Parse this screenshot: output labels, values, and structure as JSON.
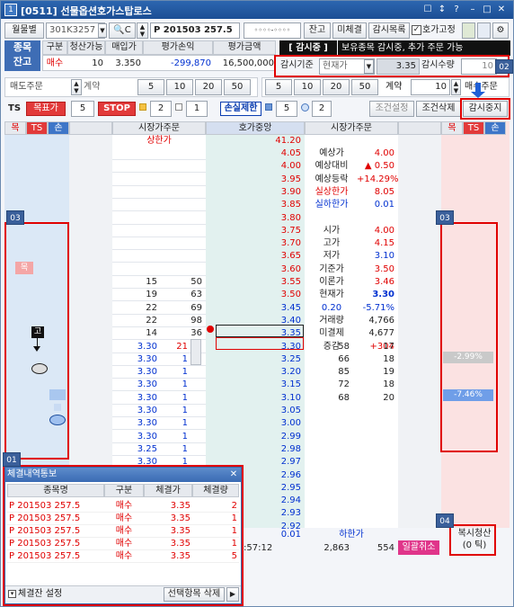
{
  "window": {
    "title_no": "1",
    "title": "[0511] 선물옵션호가스탑로스",
    "btn_labels": [
      "☐",
      "↕",
      "?",
      "–",
      "□",
      "✕"
    ]
  },
  "toolbar": {
    "mode": "월물별",
    "account": "301K3257",
    "code_prefix": "C",
    "code": "P 201503 257.5",
    "password_mask": "◦◦◦◦-◦◦◦◦",
    "balance_btn": "잔고",
    "unfilled_btn": "미체결",
    "watch_list_btn": "감시목록",
    "price_fix_label": "호가고정"
  },
  "position": {
    "tag_line1": "종목",
    "tag_line2": "잔고",
    "headers": [
      "구분",
      "청산가능",
      "매입가",
      "평가손익",
      "평가금액"
    ],
    "values": [
      "매수",
      "10",
      "3.350",
      "-299,870",
      "16,500,000"
    ]
  },
  "watch": {
    "status": "[ 감시중 ]",
    "message": "보유종목 감시중, 추가 주문 가능",
    "basis_label": "감시기준",
    "basis_value": "현재가",
    "price": "3.35",
    "qty_label": "감시수량",
    "qty_value": "10"
  },
  "order_bar_left": {
    "label": "매도주문",
    "account_label": "계약",
    "qtys": [
      "5",
      "10",
      "20",
      "50"
    ]
  },
  "order_bar_right": {
    "qtys": [
      "5",
      "10",
      "20",
      "50"
    ],
    "account_label": "계약",
    "qty": "10",
    "label": "매수주문"
  },
  "stoploss": {
    "ts_label": "TS",
    "target_label": "목표가",
    "target_val": "5",
    "stop_label": "STOP",
    "stop_val": "2",
    "stop_val2": "1",
    "loss_label": "손실제한",
    "loss_val": "5",
    "loss_val2": "2",
    "cond_set_btn": "조건설정",
    "cond_del_btn": "조건삭제",
    "watch_stop_btn": "감시중지"
  },
  "grid_headers": {
    "left_tags": [
      "목",
      "TS",
      "손"
    ],
    "col1": "시장가주문",
    "col2": "호가중앙",
    "col3": "시장가주문",
    "right_tags": [
      "목",
      "TS",
      "손"
    ]
  },
  "limit_up": {
    "label": "상한가",
    "price": "41.20"
  },
  "ask_rows": [
    {
      "q": "",
      "c": "",
      "p": "4.05"
    },
    {
      "q": "",
      "c": "",
      "p": "4.00"
    },
    {
      "q": "",
      "c": "",
      "p": "3.95"
    },
    {
      "q": "",
      "c": "",
      "p": "3.90"
    },
    {
      "q": "",
      "c": "",
      "p": "3.85"
    },
    {
      "q": "",
      "c": "",
      "p": "3.80"
    },
    {
      "q": "",
      "c": "",
      "p": "3.75"
    },
    {
      "q": "",
      "c": "",
      "p": "3.70"
    },
    {
      "q": "",
      "c": "",
      "p": "3.65"
    },
    {
      "q": "",
      "c": "",
      "p": "3.60"
    },
    {
      "q": "15",
      "c": "50",
      "p": "3.55"
    },
    {
      "q": "19",
      "c": "63",
      "p": "3.50"
    },
    {
      "q": "22",
      "c": "69",
      "p": "3.45"
    },
    {
      "q": "22",
      "c": "98",
      "p": "3.40"
    },
    {
      "q": "14",
      "c": "36",
      "p": "3.35"
    }
  ],
  "info_panel": [
    {
      "k": "예상가",
      "v": "4.00"
    },
    {
      "k": "예상대비",
      "v": "▲ 0.50"
    },
    {
      "k": "예상등락",
      "v": "+14.29%"
    },
    {
      "k": "실상한가",
      "v": "8.05"
    },
    {
      "k": "실하한가",
      "v": "0.01"
    },
    {
      "k": "",
      "v": ""
    },
    {
      "k": "시가",
      "v": "4.00"
    },
    {
      "k": "고가",
      "v": "4.15"
    },
    {
      "k": "저가",
      "v": "3.10"
    },
    {
      "k": "기준가",
      "v": "3.50"
    },
    {
      "k": "이론가",
      "v": "3.46"
    },
    {
      "k": "현재가",
      "v": "3.30"
    },
    {
      "k": "0.20",
      "v": "-5.71%"
    },
    {
      "k": "거래량",
      "v": "4,766"
    },
    {
      "k": "미결제",
      "v": "4,677"
    },
    {
      "k": "증감",
      "v": "+304"
    }
  ],
  "bid_rows": [
    {
      "lp": "3.30",
      "lq": "21",
      "p": "3.30",
      "rq": "58",
      "rc": "17"
    },
    {
      "lp": "3.30",
      "lq": "1",
      "p": "3.25",
      "rq": "66",
      "rc": "18"
    },
    {
      "lp": "3.30",
      "lq": "1",
      "p": "3.20",
      "rq": "85",
      "rc": "19"
    },
    {
      "lp": "3.30",
      "lq": "1",
      "p": "3.15",
      "rq": "72",
      "rc": "18"
    },
    {
      "lp": "3.30",
      "lq": "1",
      "p": "3.10",
      "rq": "68",
      "rc": "20"
    },
    {
      "lp": "3.30",
      "lq": "1",
      "p": "3.05",
      "rq": "",
      "rc": ""
    },
    {
      "lp": "3.30",
      "lq": "1",
      "p": "3.00",
      "rq": "",
      "rc": ""
    },
    {
      "lp": "3.30",
      "lq": "1",
      "p": "2.99",
      "rq": "",
      "rc": ""
    },
    {
      "lp": "3.25",
      "lq": "1",
      "p": "2.98",
      "rq": "",
      "rc": ""
    },
    {
      "lp": "3.30",
      "lq": "1",
      "p": "2.97",
      "rq": "",
      "rc": ""
    },
    {
      "lp": "",
      "lq": "",
      "p": "2.96",
      "rq": "",
      "rc": ""
    },
    {
      "lp": "",
      "lq": "",
      "p": "2.95",
      "rq": "",
      "rc": ""
    },
    {
      "lp": "",
      "lq": "",
      "p": "2.94",
      "rq": "",
      "rc": ""
    },
    {
      "lp": "",
      "lq": "",
      "p": "2.93",
      "rq": "",
      "rc": ""
    },
    {
      "lp": "",
      "lq": "",
      "p": "2.92",
      "rq": "",
      "rc": ""
    }
  ],
  "limit_down": {
    "price": "0.01",
    "label": "하한가"
  },
  "footer": {
    "time": ":57:12",
    "vol": "2,863",
    "qty": "554",
    "cancel_all": "일괄취소"
  },
  "markers": {
    "target_tag": "목",
    "high_tag": "고",
    "pct1": "-2.99%",
    "pct2": "-7.46%"
  },
  "popup": {
    "title": "체결내역통보",
    "headers": [
      "종목명",
      "구분",
      "체결가",
      "체결량"
    ],
    "rows": [
      {
        "name": "P 201503 257.5",
        "side": "매수",
        "price": "3.35",
        "qty": "2"
      },
      {
        "name": "P 201503 257.5",
        "side": "매수",
        "price": "3.35",
        "qty": "1"
      },
      {
        "name": "P 201503 257.5",
        "side": "매수",
        "price": "3.35",
        "qty": "1"
      },
      {
        "name": "P 201503 257.5",
        "side": "매수",
        "price": "3.35",
        "qty": "1"
      },
      {
        "name": "P 201503 257.5",
        "side": "매수",
        "price": "3.35",
        "qty": "5"
      }
    ],
    "settings": "체결잔 설정",
    "delete_selected": "선택항목 삭제"
  },
  "quick_close": {
    "line1": "복시청산",
    "line2": "(0 틱)"
  },
  "annotations": [
    "01",
    "02",
    "03",
    "03",
    "04"
  ]
}
